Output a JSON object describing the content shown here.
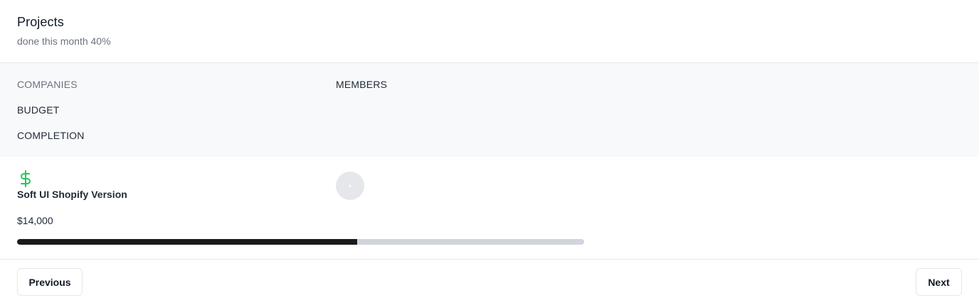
{
  "header": {
    "title": "Projects",
    "subtitle": "done this month 40%"
  },
  "table": {
    "columns": {
      "companies": "COMPANIES",
      "members": "MEMBERS",
      "budget": "BUDGET",
      "completion": "COMPLETION"
    },
    "rows": [
      {
        "icon": "dollar-icon",
        "icon_color": "#22c55e",
        "company": "Soft UI Shopify Version",
        "budget": "$14,000",
        "completion_fraction": 0.6
      }
    ]
  },
  "pagination": {
    "previous_label": "Previous",
    "next_label": "Next"
  },
  "colors": {
    "accent": "#1a1a1a",
    "success": "#22c55e",
    "muted_text": "#6b7280"
  }
}
